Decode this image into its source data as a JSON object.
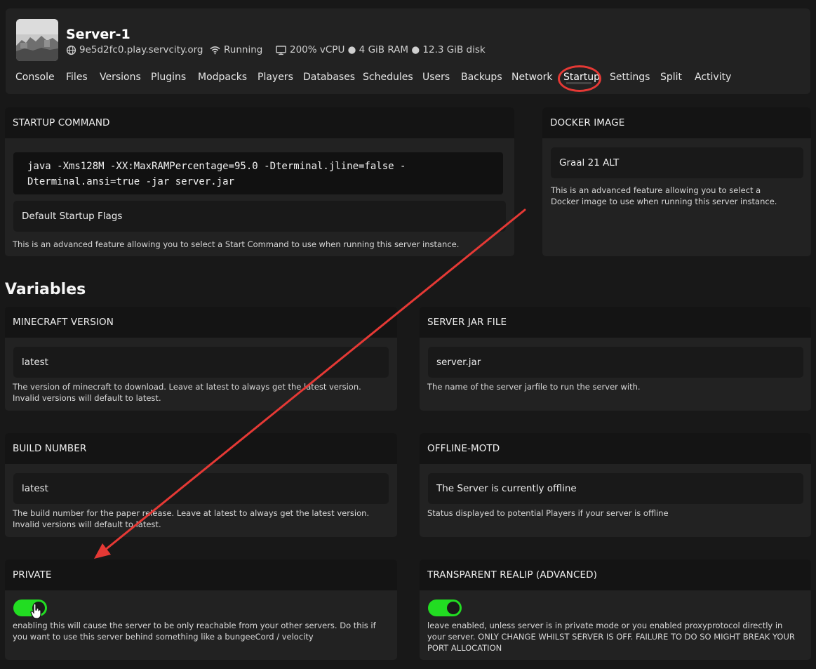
{
  "server": {
    "name": "Server-1",
    "address": "9e5d2fc0.play.servcity.org",
    "status": "Running",
    "resources": "200% vCPU ● 4 GiB RAM ● 12.3 GiB disk"
  },
  "tabs": [
    {
      "label": "Console"
    },
    {
      "label": "Files"
    },
    {
      "label": "Versions"
    },
    {
      "label": "Plugins"
    },
    {
      "label": "Modpacks"
    },
    {
      "label": "Players"
    },
    {
      "label": "Databases"
    },
    {
      "label": "Schedules"
    },
    {
      "label": "Users"
    },
    {
      "label": "Backups"
    },
    {
      "label": "Network"
    },
    {
      "label": "Startup",
      "active": true
    },
    {
      "label": "Settings"
    },
    {
      "label": "Split"
    },
    {
      "label": "Activity"
    }
  ],
  "startup": {
    "title": "STARTUP COMMAND",
    "command_line1": "java -Xms128M -XX:MaxRAMPercentage=95.0 -Dterminal.jline=false -",
    "command_line2": "Dterminal.ansi=true -jar server.jar",
    "flags_value": "Default Startup Flags",
    "description": "This is an advanced feature allowing you to select a Start Command to use when running this server instance."
  },
  "docker": {
    "title": "DOCKER IMAGE",
    "value": "Graal 21 ALT",
    "description": "This is an advanced feature allowing you to select a Docker image to use when running this server instance."
  },
  "variables_title": "Variables",
  "variables": {
    "minecraft_version": {
      "title": "MINECRAFT VERSION",
      "value": "latest",
      "description": "The version of minecraft to download. Leave at latest to always get the latest version. Invalid versions will default to latest."
    },
    "server_jar": {
      "title": "SERVER JAR FILE",
      "value": "server.jar",
      "description": "The name of the server jarfile to run the server with."
    },
    "build_number": {
      "title": "BUILD NUMBER",
      "value": "latest",
      "description": "The build number for the paper release. Leave at latest to always get the latest version. Invalid versions will default to latest."
    },
    "offline_motd": {
      "title": "OFFLINE-MOTD",
      "value": "The Server is currently offline",
      "description": "Status displayed to potential Players if your server is offline"
    },
    "private": {
      "title": "PRIVATE",
      "enabled": true,
      "description": "enabling this will cause the server to be only reachable from your other servers. Do this if you want to use this server behind something like a bungeeCord / velocity"
    },
    "transparent_realip": {
      "title": "TRANSPARENT REALIP (ADVANCED)",
      "enabled": true,
      "description": "leave enabled, unless server is in private mode or you enabled proxyprotocol directly in your server. ONLY CHANGE WHILST SERVER IS OFF. FAILURE TO DO SO MIGHT BREAK YOUR PORT ALLOCATION"
    }
  },
  "colors": {
    "accent_green": "#22dd22",
    "annotation_red": "#e53935"
  },
  "icons": {
    "address": "globe-icon",
    "status": "wifi-icon",
    "resources": "monitor-icon"
  }
}
